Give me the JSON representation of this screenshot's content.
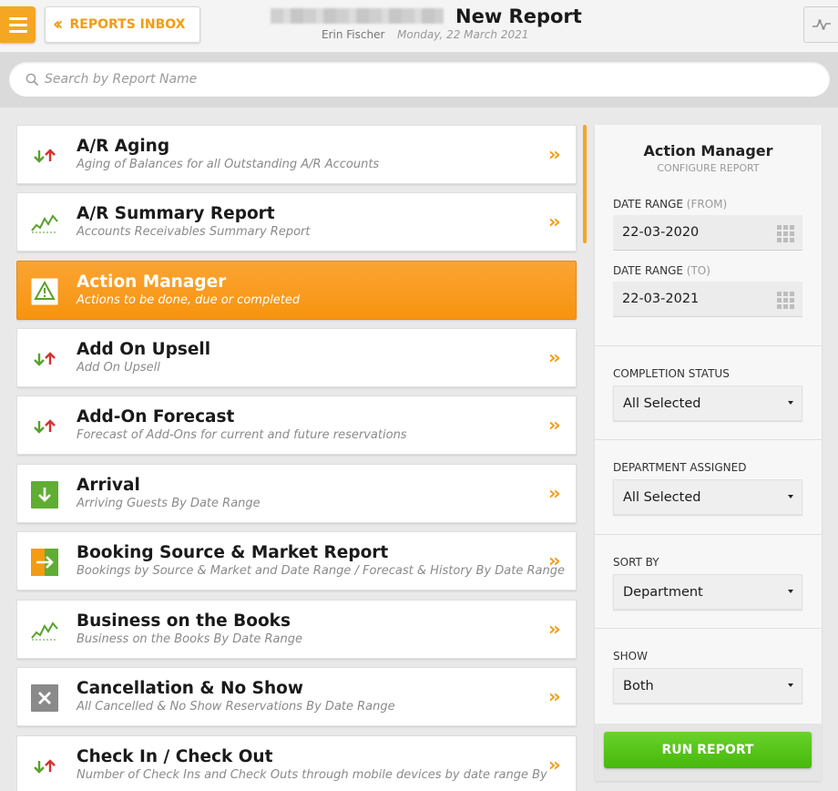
{
  "header": {
    "inbox_label": "REPORTS INBOX",
    "title": "New Report",
    "user_name": "Erin Fischer",
    "date": "Monday, 22 March 2021"
  },
  "search": {
    "placeholder": "Search by Report Name"
  },
  "reports": [
    {
      "title": "A/R Aging",
      "subtitle": "Aging of Balances for all Outstanding A/R Accounts",
      "icon": "up-down-arrows-icon",
      "active": false
    },
    {
      "title": "A/R Summary Report",
      "subtitle": "Accounts Receivables Summary Report",
      "icon": "trend-line-icon",
      "active": false
    },
    {
      "title": "Action Manager",
      "subtitle": "Actions to be done, due or completed",
      "icon": "warning-icon",
      "active": true
    },
    {
      "title": "Add On Upsell",
      "subtitle": "Add On Upsell",
      "icon": "up-down-arrows-icon",
      "active": false
    },
    {
      "title": "Add-On Forecast",
      "subtitle": "Forecast of Add-Ons for current and future reservations",
      "icon": "up-down-arrows-icon",
      "active": false
    },
    {
      "title": "Arrival",
      "subtitle": "Arriving Guests By Date Range",
      "icon": "arrival-icon",
      "active": false
    },
    {
      "title": "Booking Source & Market Report",
      "subtitle": "Bookings by Source & Market and Date Range / Forecast & History By Date Range",
      "icon": "booking-source-icon",
      "active": false
    },
    {
      "title": "Business on the Books",
      "subtitle": "Business on the Books By Date Range",
      "icon": "trend-line-icon",
      "active": false
    },
    {
      "title": "Cancellation & No Show",
      "subtitle": "All Cancelled & No Show Reservations By Date Range",
      "icon": "cancel-icon",
      "active": false
    },
    {
      "title": "Check In / Check Out",
      "subtitle": "Number of Check Ins and Check Outs through mobile devices by date range By",
      "icon": "up-down-arrows-icon",
      "active": false
    }
  ],
  "config": {
    "title": "Action Manager",
    "subtitle": "CONFIGURE REPORT",
    "date_from_label": "DATE RANGE",
    "date_from_hint": "(FROM)",
    "date_from_value": "22-03-2020",
    "date_to_label": "DATE RANGE",
    "date_to_hint": "(TO)",
    "date_to_value": "22-03-2021",
    "completion_label": "COMPLETION STATUS",
    "completion_value": "All Selected",
    "department_label": "DEPARTMENT ASSIGNED",
    "department_value": "All Selected",
    "sort_label": "SORT BY",
    "sort_value": "Department",
    "show_label": "SHOW",
    "show_value": "Both",
    "run_label": "RUN REPORT"
  },
  "colors": {
    "accent": "#f5a623",
    "run": "#52c41a"
  }
}
